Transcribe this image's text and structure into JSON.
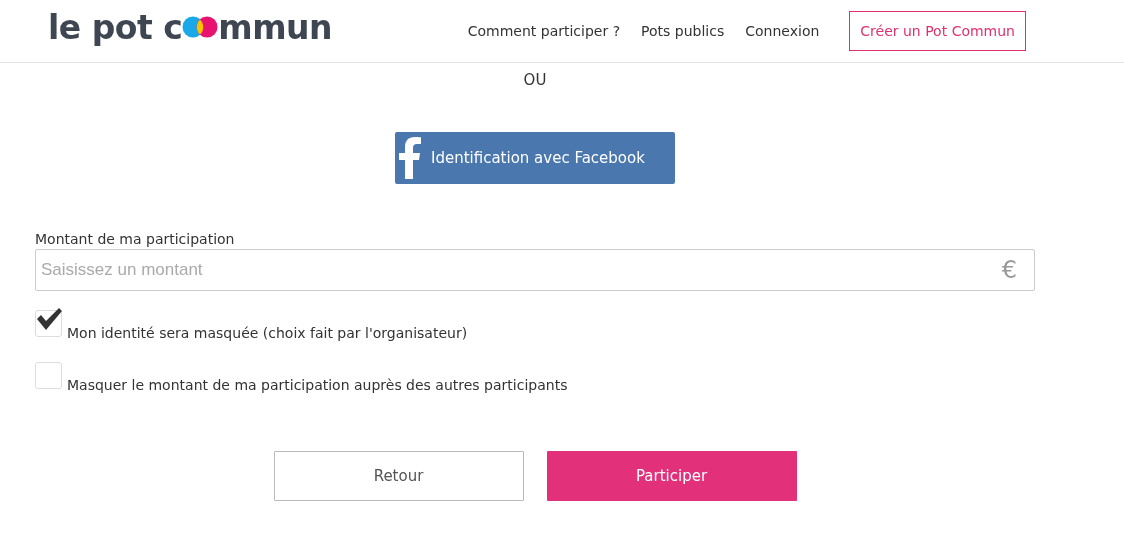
{
  "header": {
    "logo": {
      "before": "le pot c",
      "after": "mmun"
    },
    "nav": [
      {
        "label": "Comment participer ?"
      },
      {
        "label": "Pots publics"
      },
      {
        "label": "Connexion"
      }
    ],
    "cta": "Créer un Pot Commun"
  },
  "separator": "OU",
  "facebook_button": "Identification avec Facebook",
  "amount": {
    "label": "Montant de ma participation",
    "placeholder": "Saisissez un montant",
    "currency": "€"
  },
  "options": [
    {
      "label": "Mon identité sera masquée (choix fait par l'organisateur)",
      "checked": true
    },
    {
      "label": "Masquer le montant de ma participation auprès des autres participants",
      "checked": false
    }
  ],
  "buttons": [
    {
      "label": "Retour",
      "kind": "secondary"
    },
    {
      "label": "Participer",
      "kind": "primary"
    }
  ]
}
